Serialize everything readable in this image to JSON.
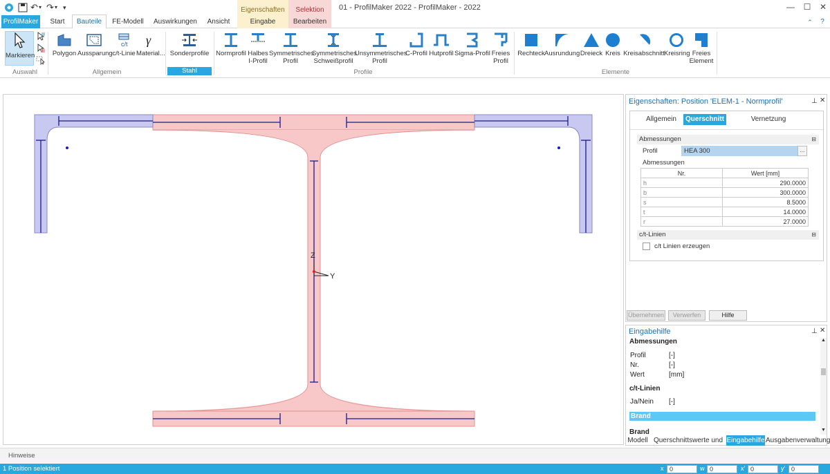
{
  "title": "01 - ProfilMaker 2022 - ProfilMaker - 2022",
  "context_tabs": [
    {
      "header": "Eigenschaften",
      "tab": "Eingabe"
    },
    {
      "header": "Selektion",
      "tab": "Bearbeiten"
    }
  ],
  "tabs": [
    "ProfilMaker",
    "Start",
    "Bauteile",
    "FE-Modell",
    "Auswirkungen",
    "Ansicht"
  ],
  "ribbon": {
    "auswahl": {
      "label": "Auswahl",
      "markieren": "Markieren"
    },
    "allgemein": {
      "label": "Allgemein",
      "buttons": [
        "Polygon",
        "Aussparung",
        "c/t-Linie",
        "Material..."
      ]
    },
    "stahl": {
      "label": "Stahl",
      "buttons": [
        "Sonderprofile"
      ]
    },
    "profile": {
      "label": "Profile",
      "buttons": [
        "Normprofil",
        "Halbes\nI-Profil",
        "Symmetrisches\nProfil",
        "Symmetrisches\nSchweißprofil",
        "Unsymmetrisches\nProfil",
        "C-Profil",
        "Hutprofil",
        "Sigma-Profil",
        "Freies\nProfil"
      ]
    },
    "elemente": {
      "label": "Elemente",
      "buttons": [
        "Rechteck",
        "Ausrundung",
        "Dreieck",
        "Kreis",
        "Kreisabschnitt",
        "Kreisring",
        "Freies\nElement"
      ]
    }
  },
  "canvas": {
    "axis_z": "Z",
    "axis_y": "Y"
  },
  "properties": {
    "title": "Eigenschaften: Position 'ELEM-1 - Normprofil'",
    "tabs": [
      "Allgemein",
      "Querschnitt",
      "Vernetzung"
    ],
    "active_tab": "Querschnitt",
    "section_abm": "Abmessungen",
    "profil_label": "Profil",
    "profil_value": "HEA 300",
    "browse": "...",
    "sub_abm": "Abmessungen",
    "table_headers": [
      "Nr.",
      "Wert [mm]"
    ],
    "rows": [
      {
        "k": "h",
        "v": "290.0000"
      },
      {
        "k": "b",
        "v": "300.0000"
      },
      {
        "k": "s",
        "v": "8.5000"
      },
      {
        "k": "t",
        "v": "14.0000"
      },
      {
        "k": "r",
        "v": "27.0000"
      }
    ],
    "section_ct": "c/t-Linien",
    "ct_checkbox": "c/t Linien erzeugen",
    "buttons": [
      "Übernehmen",
      "Verwerfen",
      "Hilfe"
    ]
  },
  "help": {
    "title": "Eingabehilfe",
    "heading": "Abmessungen",
    "entries": [
      {
        "k": "Profil",
        "v": "[-]"
      },
      {
        "k": "Nr.",
        "v": "[-]"
      },
      {
        "k": "Wert",
        "v": "[mm]"
      }
    ],
    "ct_heading": "c/t-Linien",
    "ct_entry": {
      "k": "Ja/Nein",
      "v": "[-]"
    },
    "brand_selected": "Brand",
    "brand_heading": "Brand"
  },
  "bottom_tabs": [
    "Modell",
    "Querschnittswerte und S...",
    "Eingabehilfe",
    "Ausgabenverwaltung"
  ],
  "hinweise": "Hinweise",
  "status": "1 Position selektiert",
  "coords": [
    {
      "label": "x",
      "value": "0"
    },
    {
      "label": "w",
      "value": "0"
    },
    {
      "label": "x'",
      "value": "0"
    },
    {
      "label": "y'",
      "value": "0"
    }
  ],
  "colors": {
    "accent": "#29a8e0",
    "steel_fill": "#f8c8c8",
    "plate_fill": "#c8c8f0",
    "line": "#1a1a8c"
  }
}
